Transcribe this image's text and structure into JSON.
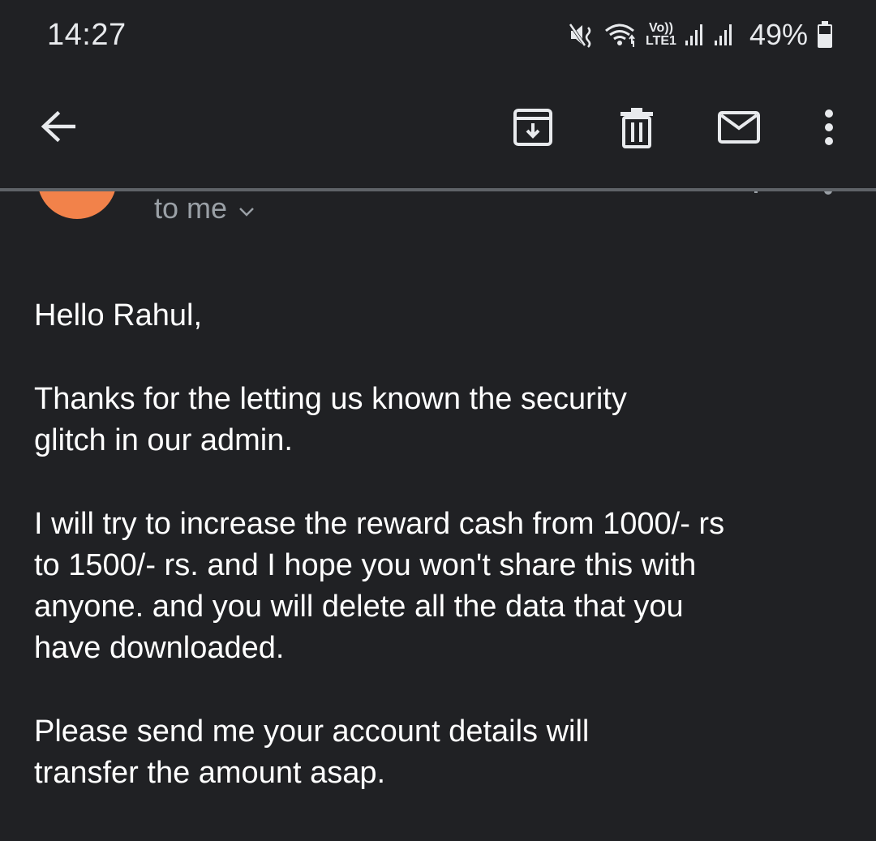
{
  "status_bar": {
    "time": "14:27",
    "battery_percent": "49%",
    "network_label_top": "Vo))",
    "network_label_bottom": "LTE1",
    "icons": [
      "mute-vibrate-icon",
      "wifi-icon",
      "volte-lte-icon",
      "signal-icon-1",
      "signal-icon-2",
      "battery-icon"
    ]
  },
  "toolbar": {
    "icons": [
      "back-arrow-icon",
      "archive-icon",
      "trash-icon",
      "mail-icon",
      "more-vert-icon"
    ]
  },
  "header": {
    "recipient_text": "to me",
    "avatar_color": "#f2824a"
  },
  "email": {
    "greeting": "Hello Rahul,",
    "paragraph_1": "Thanks for the letting us known the security\nglitch in our admin.",
    "paragraph_2": "I will try to increase the reward cash from 1000/- rs\nto 1500/- rs. and I hope you won't share this with\nanyone. and you will delete all the data that you\nhave downloaded.",
    "paragraph_3": "Please send me your account details will\ntransfer the amount asap."
  },
  "colors": {
    "background": "#202124",
    "text_primary": "#ffffff",
    "text_secondary": "#9aa0a6",
    "icon": "#e8eaed"
  }
}
